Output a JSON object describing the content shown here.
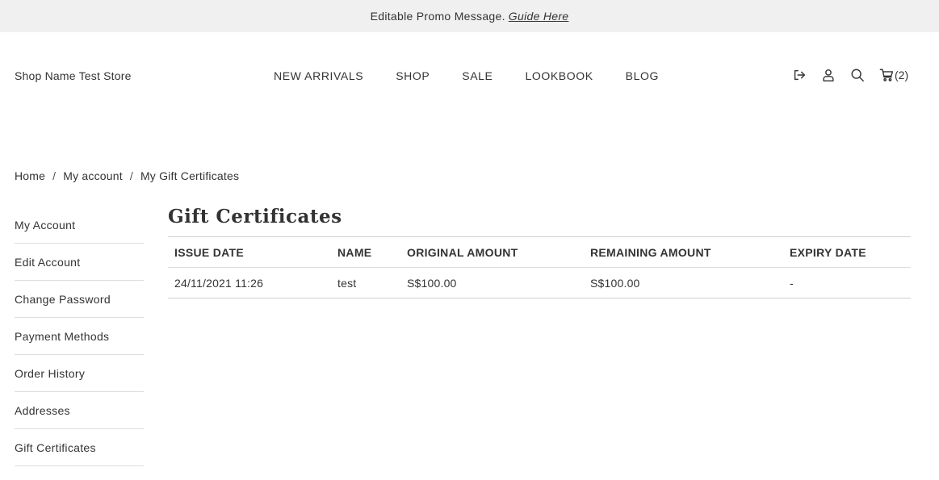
{
  "promo": {
    "message": "Editable Promo Message.",
    "link": "Guide Here"
  },
  "header": {
    "shop_name": "Shop Name Test Store",
    "nav": [
      "NEW ARRIVALS",
      "SHOP",
      "SALE",
      "LOOKBOOK",
      "BLOG"
    ],
    "cart_count": "(2)",
    "icons": [
      "logout-icon",
      "user-icon",
      "search-icon",
      "cart-icon"
    ]
  },
  "breadcrumb": {
    "items": [
      "Home",
      "My account",
      "My Gift Certificates"
    ],
    "separator": "/"
  },
  "sidebar": {
    "items": [
      "My Account",
      "Edit Account",
      "Change Password",
      "Payment Methods",
      "Order History",
      "Addresses",
      "Gift Certificates"
    ]
  },
  "main": {
    "title": "Gift Certificates",
    "table": {
      "headers": [
        "ISSUE DATE",
        "NAME",
        "ORIGINAL AMOUNT",
        "REMAINING AMOUNT",
        "EXPIRY DATE"
      ],
      "rows": [
        [
          "24/11/2021 11:26",
          "test",
          "S$100.00",
          "S$100.00",
          "-"
        ]
      ]
    }
  },
  "colors": {
    "promo_bg": "#f0f0f0",
    "text": "#333333",
    "divider": "#dddddd"
  }
}
